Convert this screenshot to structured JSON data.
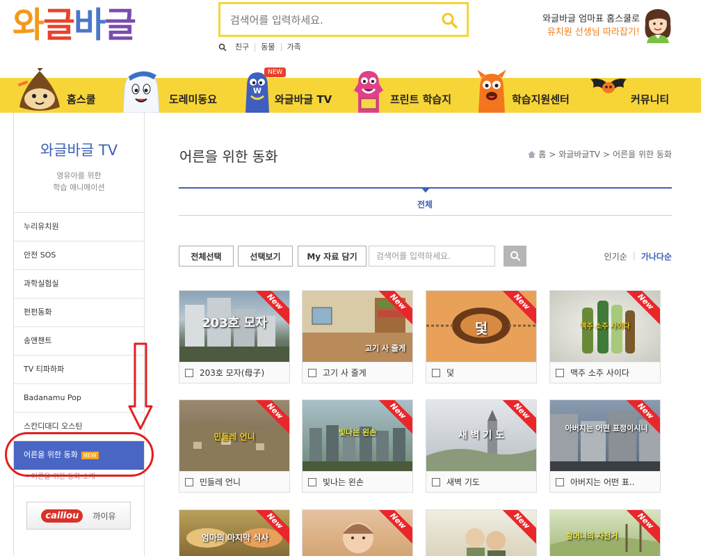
{
  "logo": {
    "text1": "와",
    "text2": "글",
    "text3": "바",
    "text4": "글"
  },
  "search": {
    "placeholder": "검색어를 입력하세요."
  },
  "search_tags": [
    "친구",
    "동물",
    "가족"
  ],
  "promo": {
    "line1": "와글바글 엄마표 홈스쿨로",
    "line2": "유치원 선생님 따라잡기!"
  },
  "nav": {
    "items": [
      {
        "label": "홈스쿨"
      },
      {
        "label": "도레미동요"
      },
      {
        "label": "와글바글 TV"
      },
      {
        "label": "프린트 학습지"
      },
      {
        "label": "학습지원센터"
      },
      {
        "label": "커뮤니티"
      }
    ],
    "new_badge": "NEW"
  },
  "sidebar": {
    "title": "와글바글 TV",
    "subtitle1": "영유아를 위한",
    "subtitle2": "학습 애니메이션",
    "items": [
      {
        "label": "누리유치원"
      },
      {
        "label": "안전 SOS"
      },
      {
        "label": "과학실험실"
      },
      {
        "label": "펀펀동화"
      },
      {
        "label": "송앤챈트"
      },
      {
        "label": "TV 티파하파"
      },
      {
        "label": "Badanamu Pop"
      },
      {
        "label": "스칸디대디 오스틴"
      }
    ],
    "active": {
      "label": "어른을 위한 동화",
      "badge": "NEW"
    },
    "sub_item": "- 어른을 위한 동화 소개",
    "caillou": {
      "logo": "caillou",
      "label": "까이유"
    }
  },
  "main": {
    "title": "어른을 위한 동화",
    "breadcrumb": {
      "home": "홈",
      "level1": "와글바글TV",
      "level2": "어른을 위한 동화",
      "sep": ">"
    },
    "tab": "전체",
    "buttons": {
      "select_all": "전체선택",
      "view_selected": "선택보기",
      "my_save": "My 자료 담기"
    },
    "filter_placeholder": "검색어를 입력하세요.",
    "sort": {
      "popular": "인기순",
      "alpha": "가나다순",
      "sep": "|"
    },
    "new_label": "New",
    "cards": [
      {
        "title": "203호 모자(母子)",
        "thumb_text": "203호 모자"
      },
      {
        "title": "고기 사 줄게",
        "thumb_text": "고기 사 줄게"
      },
      {
        "title": "덫",
        "thumb_text": "덫"
      },
      {
        "title": "맥주 소주 사이다",
        "thumb_text": "맥주 소주 사이다"
      },
      {
        "title": "민들레 언니",
        "thumb_text": "민들레 언니"
      },
      {
        "title": "빛나는 왼손",
        "thumb_text": "빛나는 왼손"
      },
      {
        "title": "새벽 기도",
        "thumb_text": "새 벽 기 도"
      },
      {
        "title": "아버지는 어떤 표..",
        "thumb_text": "아버지는 어떤 표정이시니"
      },
      {
        "title": "",
        "thumb_text": "엄마의 마지막 식사"
      },
      {
        "title": "",
        "thumb_text": ""
      },
      {
        "title": "",
        "thumb_text": ""
      },
      {
        "title": "",
        "thumb_text": "할머니의 자전거"
      }
    ]
  },
  "colors": {
    "accent": "#f8d537",
    "brand_blue": "#3d61b4",
    "active_blue": "#4966c4",
    "new_red": "#e9272b",
    "annotation_red": "#e21e1e"
  }
}
